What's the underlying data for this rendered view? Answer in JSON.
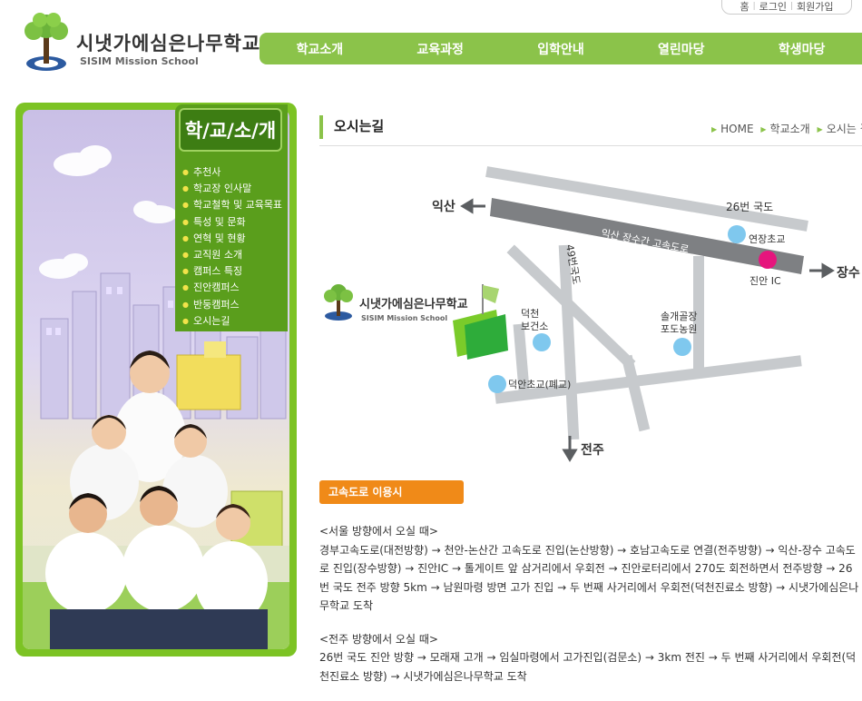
{
  "util": {
    "home": "홈",
    "login": "로그인",
    "join": "회원가입"
  },
  "logo": {
    "title": "시냇가에심은나무학교",
    "subtitle": "SISIM Mission School"
  },
  "nav": [
    "학교소개",
    "교육과정",
    "입학안내",
    "열린마당",
    "학생마당"
  ],
  "sidebar": {
    "title": "학/교/소/개",
    "items": [
      "추천사",
      "학교장 인사말",
      "학교철학 및 교육목표",
      "특성 및 문화",
      "연혁 및 현황",
      "교직원 소개",
      "캠퍼스 특징",
      "진안캠퍼스",
      "반둥캠퍼스",
      "오시는길"
    ]
  },
  "page": {
    "title": "오시는길",
    "breadcrumb": [
      "HOME",
      "학교소개",
      "오시는 길"
    ]
  },
  "map": {
    "iksan": "익산",
    "jangsu": "장수",
    "jeonju": "전주",
    "route26": "26번 국도",
    "route49": "49번국도",
    "highway": "익산 장수간 고속도로",
    "yeonjang": "연장초교",
    "jinan_ic": "진안 IC",
    "health": "덕천 보건소",
    "health1": "덕천",
    "health2": "보건소",
    "farm1": "솔개골장",
    "farm2": "포도농원",
    "dukan": "덕안초교(폐교)",
    "school_name": "시냇가에심은나무학교",
    "school_sub": "SISIM Mission School"
  },
  "highway_label": "고속도로 이용시",
  "directions": [
    {
      "heading": "<서울 방향에서 오실 때>",
      "text": "경부고속도로(대전방향) → 천안-논산간 고속도로 진입(논산방향) → 호남고속도로 연결(전주방향) → 익산-장수 고속도로 진입(장수방향) → 진안IC → 톨게이트 앞 삼거리에서 우회전 → 진안로터리에서 270도 회전하면서 전주방향 → 26번 국도 전주 방향 5km → 남원마령 방면 고가 진입 → 두 번째 사거리에서 우회전(덕천진료소 방향) → 시냇가에심은나무학교 도착"
    },
    {
      "heading": "<전주 방향에서 오실 때>",
      "text": "26번 국도 진안 방향 → 모래재 고개 → 임실마령에서 고가진입(검문소) → 3km 전진 → 두 번째 사거리에서 우회전(덕천진료소 방향) → 시냇가에심은나무학교 도착"
    }
  ]
}
